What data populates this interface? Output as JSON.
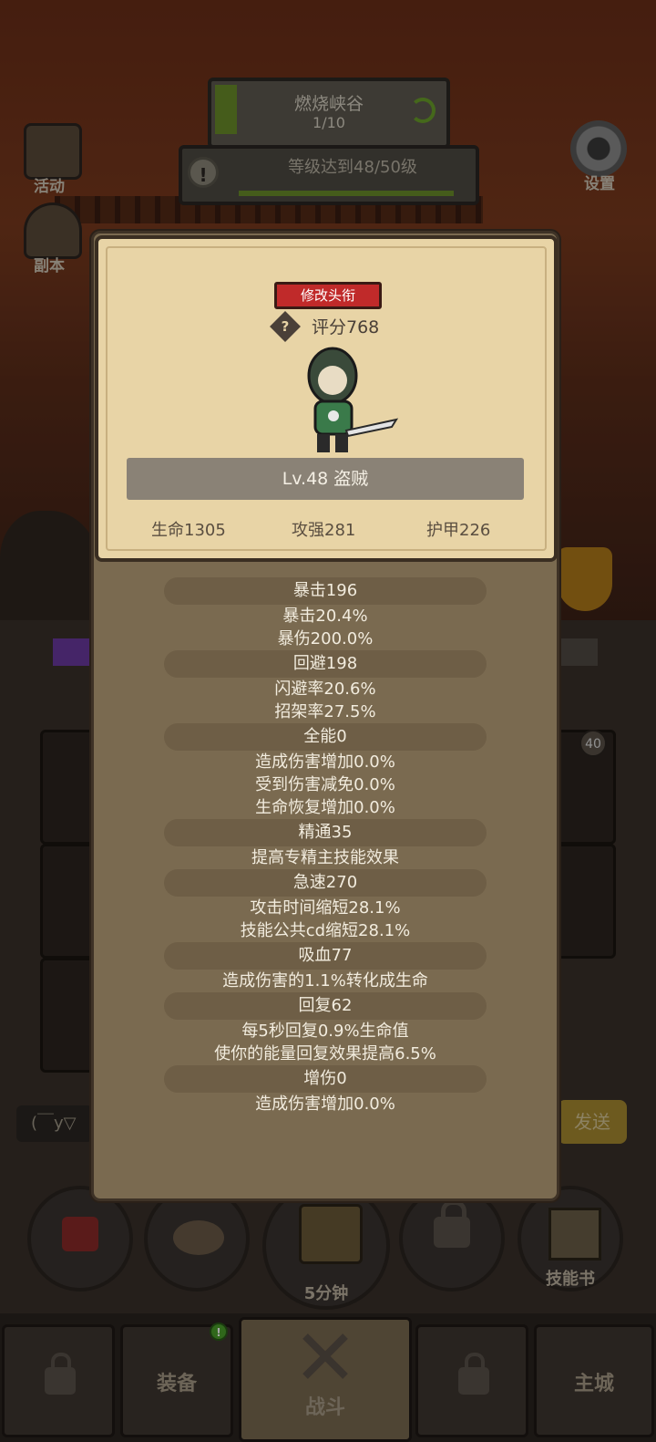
{
  "hud": {
    "stage_name": "燃烧峡谷",
    "stage_count": "1/10",
    "quest_text": "等级达到48/50级",
    "quest_info_icon": "!",
    "events_label": "活动",
    "dungeon_label": "副本",
    "settings_label": "设置"
  },
  "background": {
    "chat_placeholder": "(￣y▽",
    "send_label": "发送",
    "badge_count": "40",
    "timer_label": "5分钟",
    "skill_book_label": "技能书"
  },
  "nav": {
    "equipment_label": "装备",
    "battle_label": "战斗",
    "main_city_label": "主城",
    "notify_badge": "!"
  },
  "profile": {
    "change_title_label": "修改头衔",
    "help_icon": "?",
    "score": "评分768",
    "level_class": "Lv.48 盗贼",
    "hp": "生命1305",
    "attack": "攻强281",
    "armor": "护甲226"
  },
  "stats": [
    {
      "head": "暴击196",
      "lines": [
        "暴击20.4%",
        "暴伤200.0%"
      ]
    },
    {
      "head": "回避198",
      "lines": [
        "闪避率20.6%",
        "招架率27.5%"
      ]
    },
    {
      "head": "全能0",
      "lines": [
        "造成伤害增加0.0%",
        "受到伤害减免0.0%",
        "生命恢复增加0.0%"
      ]
    },
    {
      "head": "精通35",
      "lines": [
        "提高专精主技能效果"
      ]
    },
    {
      "head": "急速270",
      "lines": [
        "攻击时间缩短28.1%",
        "技能公共cd缩短28.1%"
      ]
    },
    {
      "head": "吸血77",
      "lines": [
        "造成伤害的1.1%转化成生命"
      ]
    },
    {
      "head": "回复62",
      "lines": [
        "每5秒回复0.9%生命值",
        "使你的能量回复效果提高6.5%"
      ]
    },
    {
      "head": "增伤0",
      "lines": [
        "造成伤害增加0.0%"
      ]
    }
  ],
  "colors": {
    "title_button": "#c02a2a",
    "card_bg": "#e8d4a6",
    "modal_bg": "#7a6a50",
    "stat_head_bg": "#6e5e46"
  }
}
